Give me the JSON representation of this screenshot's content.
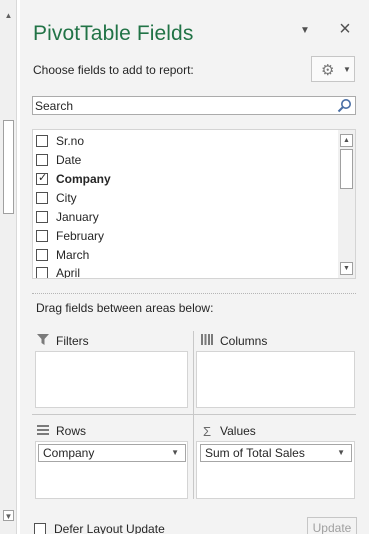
{
  "pane": {
    "title": "PivotTable Fields",
    "choose_label": "Choose fields to add to report:",
    "search_placeholder": "Search",
    "fields": [
      {
        "label": "Sr.no",
        "checked": false
      },
      {
        "label": "Date",
        "checked": false
      },
      {
        "label": "Company",
        "checked": true
      },
      {
        "label": "City",
        "checked": false
      },
      {
        "label": "January",
        "checked": false
      },
      {
        "label": "February",
        "checked": false
      },
      {
        "label": "March",
        "checked": false
      },
      {
        "label": "April",
        "checked": false
      }
    ],
    "drag_label": "Drag fields between areas below:",
    "areas": {
      "filters": {
        "label": "Filters",
        "icon": "filter-icon"
      },
      "columns": {
        "label": "Columns",
        "icon": "columns-icon"
      },
      "rows": {
        "label": "Rows",
        "icon": "rows-icon",
        "items": [
          "Company"
        ]
      },
      "values": {
        "label": "Values",
        "icon": "sigma-icon",
        "items": [
          "Sum of Total Sales"
        ]
      }
    },
    "defer_label": "Defer Layout Update",
    "update_label": "Update"
  },
  "colors": {
    "accent": "#217346",
    "pane_bg": "#f3f3f3"
  }
}
